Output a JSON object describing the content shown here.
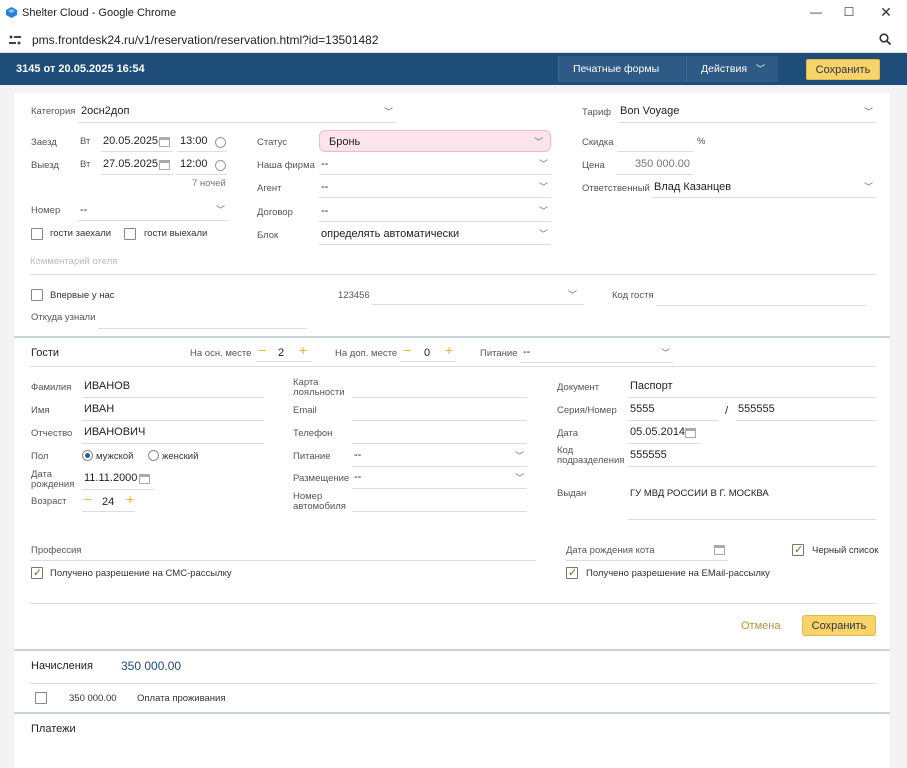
{
  "window": {
    "title": "Shelter Cloud - Google Chrome",
    "url": "pms.frontdesk24.ru/v1/reservation/reservation.html?id=13501482"
  },
  "header": {
    "title": "3145 от 20.05.2025 16:54",
    "print_forms": "Печатные формы",
    "actions": "Действия",
    "save": "Сохранить"
  },
  "booking": {
    "category_label": "Категория",
    "category_value": "2осн2доп",
    "checkin_label": "Заезд",
    "checkin_day": "Вт",
    "checkin_date": "20.05.2025",
    "checkin_time": "13:00",
    "checkout_label": "Выезд",
    "checkout_day": "Вт",
    "checkout_date": "27.05.2025",
    "checkout_time": "12:00",
    "nights": "7 ночей",
    "room_label": "Номер",
    "room_value": "--",
    "guests_in": "гости заехали",
    "guests_out": "гости выехали",
    "status_label": "Статус",
    "status_value": "Бронь",
    "firm_label": "Наша фирма",
    "firm_value": "--",
    "agent_label": "Агент",
    "agent_value": "--",
    "contract_label": "Договор",
    "contract_value": "--",
    "block_label": "Блок",
    "block_value": "определять автоматически",
    "tariff_label": "Тариф",
    "tariff_value": "Bon Voyage",
    "discount_label": "Скидка",
    "discount_unit": "%",
    "price_label": "Цена",
    "price_value": "350 000.00",
    "responsible_label": "Ответственный",
    "responsible_value": "Влад Казанцев",
    "hotel_comment_placeholder": "Комментарий отеля",
    "first_time_label": "Впервые у нас",
    "guest_search_value": "123456",
    "guest_code_label": "Код гостя",
    "source_label": "Откуда узнали"
  },
  "guests": {
    "title": "Гости",
    "main_place_label": "На осн. месте",
    "main_place_count": "2",
    "extra_place_label": "На доп. месте",
    "extra_place_count": "0",
    "meal_label": "Питание",
    "meal_value": "--",
    "lastname_label": "Фамилия",
    "lastname_value": "ИВАНОВ",
    "firstname_label": "Имя",
    "firstname_value": "ИВАН",
    "middlename_label": "Отчество",
    "middlename_value": "ИВАНОВИЧ",
    "gender_label": "Пол",
    "gender_male": "мужской",
    "gender_female": "женский",
    "birthdate_label1": "Дата",
    "birthdate_label2": "рождения",
    "birthdate_value": "11.11.2000",
    "age_label": "Возраст",
    "age_value": "24",
    "loyalty_label1": "Карта",
    "loyalty_label2": "лояльности",
    "email_label": "Email",
    "phone_label": "Телефон",
    "guest_meal_label": "Питание",
    "guest_meal_value": "--",
    "accommodation_label": "Размещение",
    "accommodation_value": "--",
    "car_label1": "Номер",
    "car_label2": "автомобиля",
    "document_label": "Документ",
    "document_value": "Паспорт",
    "series_label": "Серия/Номер",
    "series_value": "5555",
    "number_separator": "/",
    "number_value": "555555",
    "doc_date_label": "Дата",
    "doc_date_value": "05.05.2014",
    "division_label1": "Код",
    "division_label2": "подразделения",
    "division_value": "555555",
    "issued_label": "Выдан",
    "issued_value": "ГУ МВД РОССИИ В Г. МОСКВА",
    "profession_label": "Профессия",
    "cat_birthday_label": "Дата рождения кота",
    "blacklist_label": "Черный список",
    "sms_label": "Получено разрешение на СМС-рассылку",
    "email_permission_label": "Получено разрешение на EMail-рассылку",
    "cancel": "Отмена",
    "save": "Сохранить"
  },
  "charges": {
    "title": "Начисления",
    "total": "350 000.00",
    "row_amount": "350 000.00",
    "row_name": "Оплата проживания"
  },
  "payments": {
    "title": "Платежи"
  }
}
